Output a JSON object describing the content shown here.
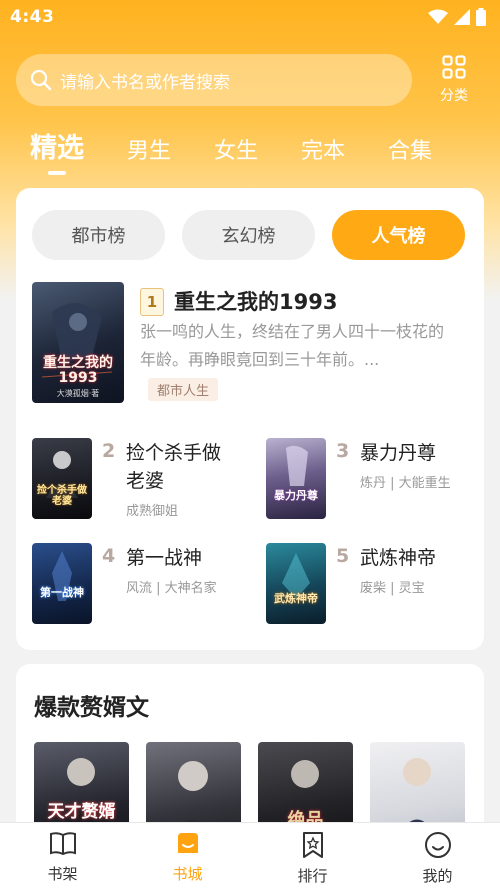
{
  "status": {
    "time": "4:43"
  },
  "search": {
    "placeholder": "请输入书名或作者搜索",
    "category_label": "分类"
  },
  "tabs": [
    {
      "label": "精选",
      "active": true
    },
    {
      "label": "男生"
    },
    {
      "label": "女生"
    },
    {
      "label": "完本"
    },
    {
      "label": "合集"
    }
  ],
  "rank_tabs": [
    {
      "label": "都市榜"
    },
    {
      "label": "玄幻榜"
    },
    {
      "label": "人气榜",
      "active": true
    }
  ],
  "first_book": {
    "rank": "1",
    "title": "重生之我的1993",
    "description": "张一鸣的人生，终结在了男人四十一枝花的年龄。再睁眼竟回到三十年前。...",
    "tag": "都市人生",
    "cover_text_main": "重生之我的1993",
    "cover_text_sub": "大漠孤烟·著"
  },
  "books": [
    {
      "rank": "2",
      "title": "捡个杀手做老婆",
      "meta": "成熟御姐",
      "cover_text": "捡个杀手做老婆"
    },
    {
      "rank": "3",
      "title": "暴力丹尊",
      "meta": "炼丹 | 大能重生",
      "cover_text": "暴力丹尊"
    },
    {
      "rank": "4",
      "title": "第一战神",
      "meta": "风流 | 大神名家",
      "cover_text": "第一战神"
    },
    {
      "rank": "5",
      "title": "武炼神帝",
      "meta": "废柴 | 灵宝",
      "cover_text": "武炼神帝"
    }
  ],
  "section": {
    "title": "爆款赘婿文",
    "cover_text_1": "天才赘婿",
    "cover_text_3": "绝品"
  },
  "bottom_nav": [
    {
      "label": "书架",
      "icon": "bookshelf-icon"
    },
    {
      "label": "书城",
      "icon": "bookstore-icon",
      "active": true
    },
    {
      "label": "排行",
      "icon": "ranking-icon"
    },
    {
      "label": "我的",
      "icon": "profile-icon"
    }
  ],
  "colors": {
    "accent": "#ffaa14",
    "header_top": "#ffb21f"
  }
}
